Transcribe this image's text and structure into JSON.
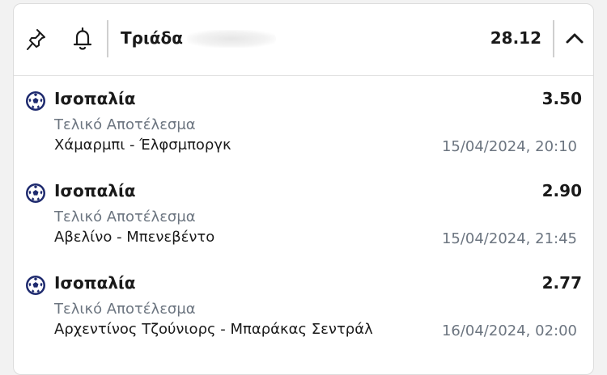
{
  "header": {
    "title": "Τριάδα",
    "total_odds": "28.12",
    "icons": {
      "pin": "pin-icon",
      "bell": "bell-icon",
      "collapse": "chevron-up-icon"
    }
  },
  "bets": [
    {
      "selection": "Ισοπαλία",
      "odds": "3.50",
      "market": "Τελικό Αποτέλεσμα",
      "match": "Χάμαρμπι - Έλφσμποργκ",
      "datetime": "15/04/2024, 20:10",
      "icon": "football-icon"
    },
    {
      "selection": "Ισοπαλία",
      "odds": "2.90",
      "market": "Τελικό Αποτέλεσμα",
      "match": "Αβελίνο - Μπενεβέντο",
      "datetime": "15/04/2024, 21:45",
      "icon": "football-icon"
    },
    {
      "selection": "Ισοπαλία",
      "odds": "2.77",
      "market": "Τελικό Αποτέλεσμα",
      "match": "Αρχεντίνος Τζούνιορς - Μπαράκας Σεντράλ",
      "datetime": "16/04/2024, 02:00",
      "icon": "football-icon"
    }
  ],
  "colors": {
    "text": "#1a1a1a",
    "secondary": "#6c7580",
    "ball": "#1e2a6e"
  }
}
